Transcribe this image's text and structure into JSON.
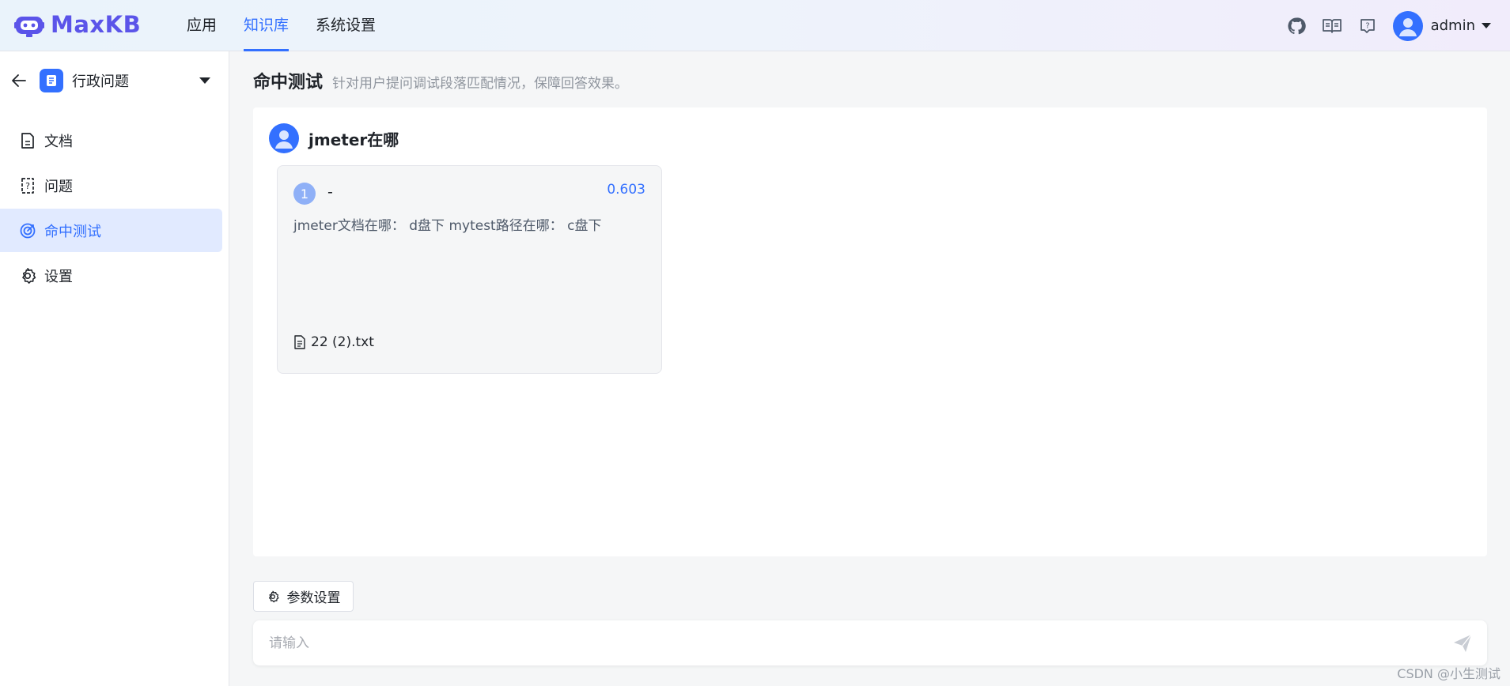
{
  "app": {
    "name": "MaxKB",
    "brand_color": "#5b54e9",
    "accent": "#3370ff"
  },
  "nav": [
    {
      "label": "应用",
      "active": false
    },
    {
      "label": "知识库",
      "active": true
    },
    {
      "label": "系统设置",
      "active": false
    }
  ],
  "header_icons": [
    "github-icon",
    "book-icon",
    "help-icon"
  ],
  "user": {
    "name": "admin"
  },
  "sidebar": {
    "kb_name": "行政问题",
    "items": [
      {
        "label": "文档",
        "icon": "document-icon",
        "active": false
      },
      {
        "label": "问题",
        "icon": "question-icon",
        "active": false
      },
      {
        "label": "命中测试",
        "icon": "target-icon",
        "active": true
      },
      {
        "label": "设置",
        "icon": "gear-icon",
        "active": false
      }
    ]
  },
  "page": {
    "title": "命中测试",
    "subtitle": "针对用户提问调试段落匹配情况，保障回答效果。"
  },
  "query": {
    "text": "jmeter在哪"
  },
  "results": [
    {
      "index": "1",
      "title": "-",
      "score": "0.603",
      "content": "jmeter文档在哪：  d盘下 mytest路径在哪：  c盘下",
      "file": "22 (2).txt"
    }
  ],
  "params_button": "参数设置",
  "input": {
    "placeholder": "请输入",
    "value": ""
  },
  "watermark": "CSDN @小生测试"
}
